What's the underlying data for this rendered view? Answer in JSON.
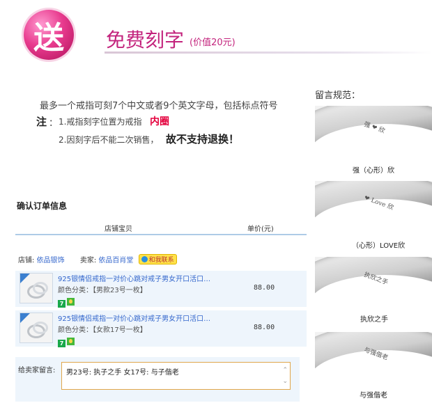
{
  "header": {
    "badge_char": "送",
    "title": "免费刻字",
    "subtitle": "(价值20元)",
    "colors": {
      "accent": "#c3247d",
      "warning": "#e4003d"
    }
  },
  "notice": {
    "line1": "最多一个戒指可刻7个中文或者9个英文字母，包括标点符号",
    "label": "注",
    "colon": "：",
    "item1": "1.戒指刻字位置为戒指",
    "item1_em": "内圈",
    "item2": "2.因刻字后不能二次销售，",
    "item2_em": "故不支持退换！"
  },
  "order": {
    "title": "确认订单信息",
    "col_shop": "店铺宝贝",
    "col_price": "单价(元)",
    "shop_label": "店铺:",
    "shop_name": "依品银饰",
    "seller_label": "卖家:",
    "seller_name": "依品百肖堂",
    "contact_label": "和我联系",
    "items": [
      {
        "title": "925银情侣戒指一对价心跳对戒子男女开口活口…",
        "spec": "颜色分类：【男款23号一枚】",
        "price": "88.00"
      },
      {
        "title": "925银情侣戒指一对价心跳对戒子男女开口活口…",
        "spec": "颜色分类：【女款17号一枚】",
        "price": "88.00"
      }
    ],
    "message_label": "给卖家留言:",
    "message_value": "男23号: 执子之手   女17号: 与子偕老",
    "icons": [
      "ring-thumbnail-icon",
      "tmall-7-icon",
      "gift-icon",
      "chevron-up-icon",
      "chevron-down-icon"
    ]
  },
  "rules": {
    "title": "留言规范：",
    "examples": [
      {
        "engraving": "强 ❤ 欣",
        "caption": "强（心形）欣"
      },
      {
        "engraving": "❤ Love 欣",
        "caption": "（心形）LOVE欣"
      },
      {
        "engraving": "执欣之手",
        "caption": "执欣之手"
      },
      {
        "engraving": "与强偕老",
        "caption": "与强偕老"
      }
    ]
  }
}
